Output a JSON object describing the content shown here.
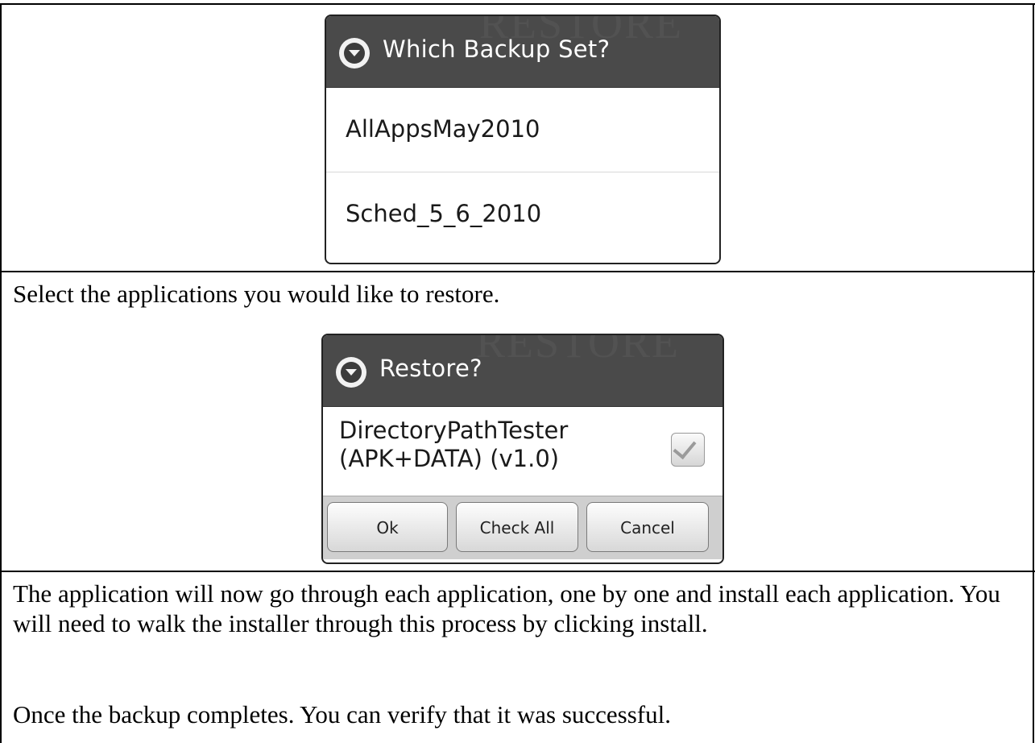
{
  "dialog_backup_set": {
    "title": "Which Backup Set?",
    "watermark": "RESTORE",
    "items": [
      {
        "label": "AllAppsMay2010"
      },
      {
        "label": "Sched_5_6_2010"
      }
    ]
  },
  "instruction_select": "Select the applications you would like to restore.",
  "dialog_restore": {
    "title": "Restore?",
    "watermark": "RESTORE",
    "app_line1": "DirectoryPathTester",
    "app_line2": "(APK+DATA) (v1.0)",
    "checked": true,
    "buttons": {
      "ok": "Ok",
      "check_all": "Check All",
      "cancel": "Cancel"
    }
  },
  "paragraph_install": "The application will now go through each application, one by one and install each application. You will need to walk the installer through this process by clicking install.",
  "paragraph_verify": "Once the backup completes. You can verify that it was successful.",
  "colors": {
    "dialog_header": "#4a4a4a",
    "button_bar": "#cfcfcf"
  }
}
